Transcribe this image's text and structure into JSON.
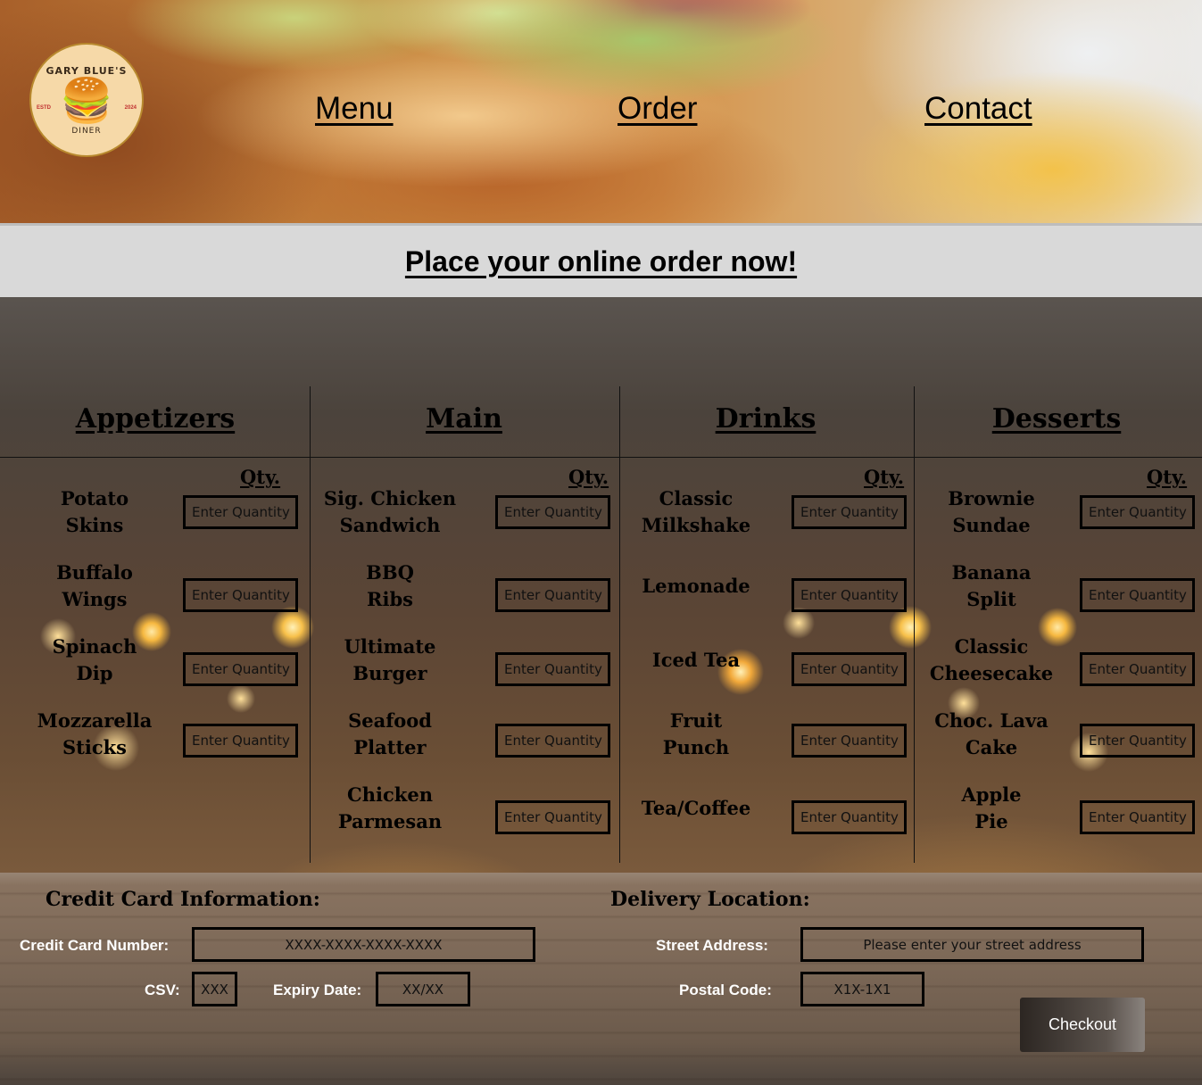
{
  "header": {
    "logo": {
      "top_text": "GARY BLUE'S",
      "bottom_text": "DINER",
      "est": "ESTD",
      "year": "2024"
    },
    "nav": [
      {
        "label": "Menu"
      },
      {
        "label": "Order"
      },
      {
        "label": "Contact"
      }
    ]
  },
  "banner": {
    "title": "Place your online order now!"
  },
  "menu": {
    "qty_label": "Qty.",
    "placeholder": "Enter Quantity",
    "columns": [
      {
        "title": "Appetizers",
        "items": [
          "Potato\nSkins",
          "Buffalo\nWings",
          "Spinach\nDip",
          "Mozzarella\nSticks"
        ]
      },
      {
        "title": "Main",
        "items": [
          "Sig. Chicken\nSandwich",
          "BBQ\nRibs",
          "Ultimate\nBurger",
          "Seafood\nPlatter",
          "Chicken\nParmesan"
        ]
      },
      {
        "title": "Drinks",
        "items": [
          "Classic\nMilkshake",
          "Lemonade",
          "Iced Tea",
          "Fruit\nPunch",
          "Tea/Coffee"
        ]
      },
      {
        "title": "Desserts",
        "items": [
          "Brownie\nSundae",
          "Banana\nSplit",
          "Classic\nCheesecake",
          "Choc. Lava\nCake",
          "Apple\nPie"
        ]
      }
    ]
  },
  "checkout": {
    "credit_card": {
      "title": "Credit Card Information:",
      "number_label": "Credit Card Number:",
      "number_placeholder": "XXXX-XXXX-XXXX-XXXX",
      "csv_label": "CSV:",
      "csv_placeholder": "XXX",
      "expiry_label": "Expiry Date:",
      "expiry_placeholder": "XX/XX"
    },
    "delivery": {
      "title": "Delivery Location:",
      "street_label": "Street Address:",
      "street_placeholder": "Please enter your street address",
      "postal_label": "Postal Code:",
      "postal_placeholder": "X1X-1X1"
    },
    "button_label": "Checkout"
  }
}
